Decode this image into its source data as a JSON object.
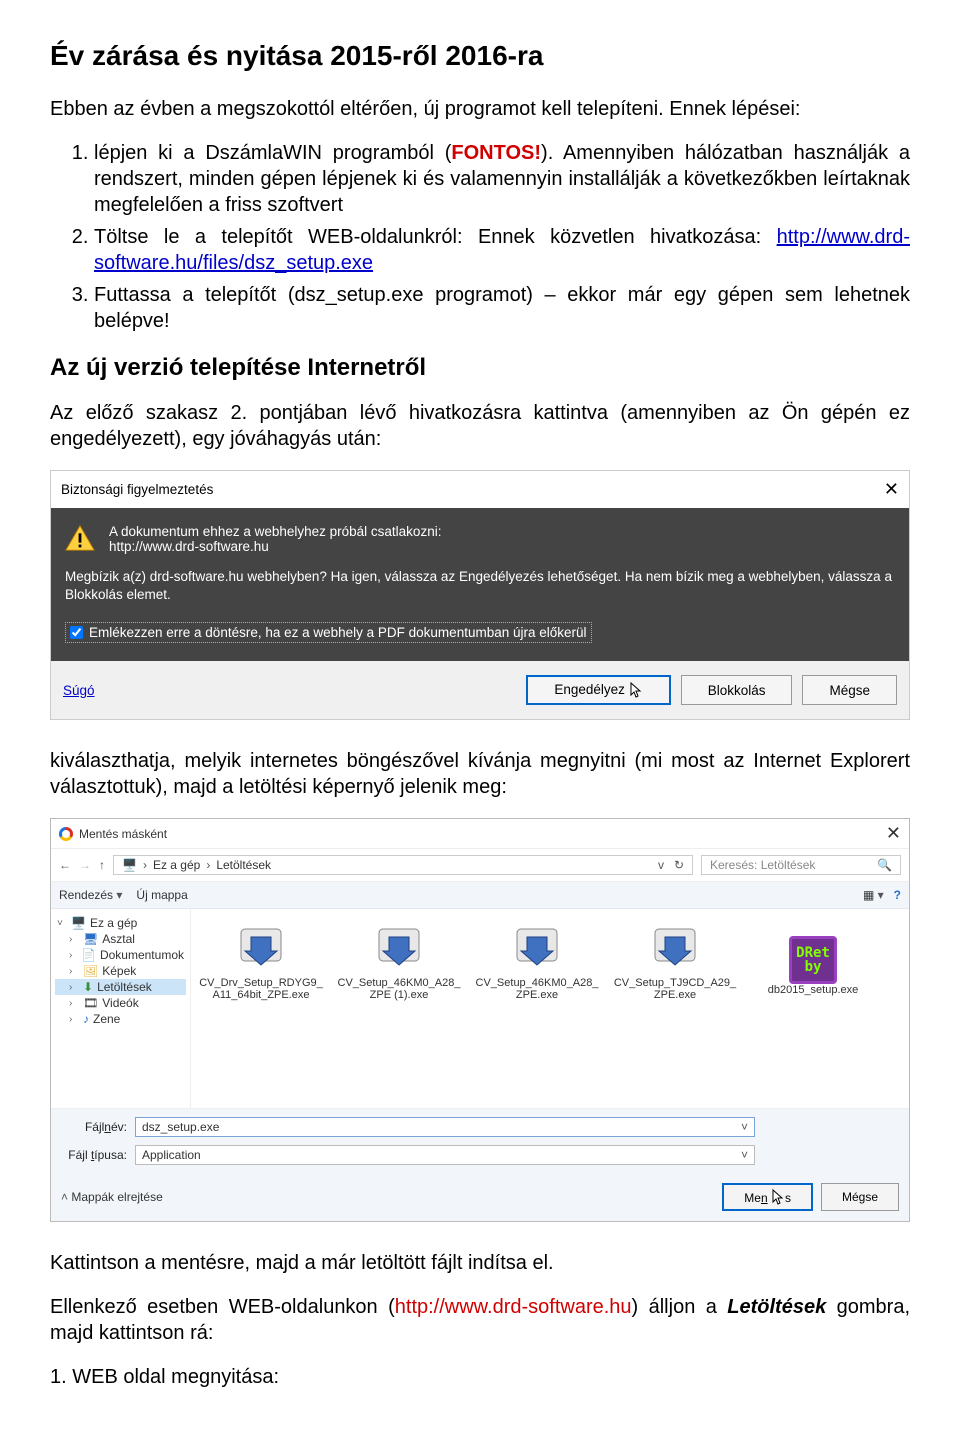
{
  "doc": {
    "title": "Év zárása és nyitása 2015-ről 2016-ra",
    "intro": "Ebben az évben a megszokottól eltérően, új programot kell telepíteni. Ennek lépései:",
    "li1_a": "lépjen ki a DszámlaWIN programból (",
    "li1_b": "FONTOS!",
    "li1_c": "). Amennyiben hálózatban használják a rendszert, minden gépen lépjenek ki és valamennyin installálják a következőkben leírtaknak megfelelően a friss szoftvert",
    "li2_a": "Töltse le a telepítőt WEB-oldalunkról: Ennek közvetlen hivatkozása: ",
    "li2_link": "http://www.drd-software.hu/files/dsz_setup.exe",
    "li3": "Futtassa a telepítőt (dsz_setup.exe programot) – ekkor már egy gépen sem lehetnek belépve!",
    "h2": "Az új verzió telepítése Internetről",
    "para2": "Az előző szakasz 2. pontjában lévő hivatkozásra kattintva (amennyiben az Ön gépén ez engedélyezett), egy jóváhagyás után:",
    "para3": "kiválaszthatja, melyik internetes böngészővel kívánja megnyitni (mi most az Internet Explorert választottuk), majd a letöltési képernyő jelenik meg:",
    "para4": "Kattintson a mentésre, majd a már letöltött fájlt indítsa el.",
    "para5_a": "Ellenkező esetben WEB-oldalunkon (",
    "para5_link": "http://www.drd-software.hu",
    "para5_b": ") álljon a ",
    "para5_c": "Letöltések",
    "para5_d": " gombra, majd kattintson rá:",
    "para6": "1. WEB oldal megnyitása:"
  },
  "dlg1": {
    "title": "Biztonsági figyelmeztetés",
    "line1": "A dokumentum ehhez a webhelyhez próbál csatlakozni:",
    "url": "http://www.drd-software.hu",
    "line2": "Megbízik a(z) drd-software.hu webhelyben? Ha igen, válassza az Engedélyezés lehetőséget. Ha nem bízik meg a webhelyben, válassza a Blokkolás elemet.",
    "checkbox": "Emlékezzen erre a döntésre, ha ez a webhely a PDF dokumentumban újra előkerül",
    "help": "Súgó",
    "btn_allow": "Engedélyez",
    "btn_block": "Blokkolás",
    "btn_cancel": "Mégse"
  },
  "dlg2": {
    "title": "Mentés másként",
    "breadcrumb_a": "Ez a gép",
    "breadcrumb_b": "Letöltések",
    "search_placeholder": "Keresés: Letöltések",
    "toolbar_sort": "Rendezés",
    "toolbar_newfolder": "Új mappa",
    "nav": [
      "Ez a gép",
      "Asztal",
      "Dokumentumok",
      "Képek",
      "Letöltések",
      "Videók",
      "Zene"
    ],
    "files": [
      "CV_Drv_Setup_RDYG9_A11_64bit_ZPE.exe",
      "CV_Setup_46KM0_A28_ZPE (1).exe",
      "CV_Setup_46KM0_A28_ZPE.exe",
      "CV_Setup_TJ9CD_A29_ZPE.exe",
      "db2015_setup.exe"
    ],
    "field_name_label": "Fájlnév:",
    "field_name_value": "dsz_setup.exe",
    "field_type_label": "Fájl típusa:",
    "field_type_value": "Application",
    "hide_folders": "Mappák elrejtése",
    "btn_save": "Mentés",
    "btn_cancel": "Mégse"
  }
}
